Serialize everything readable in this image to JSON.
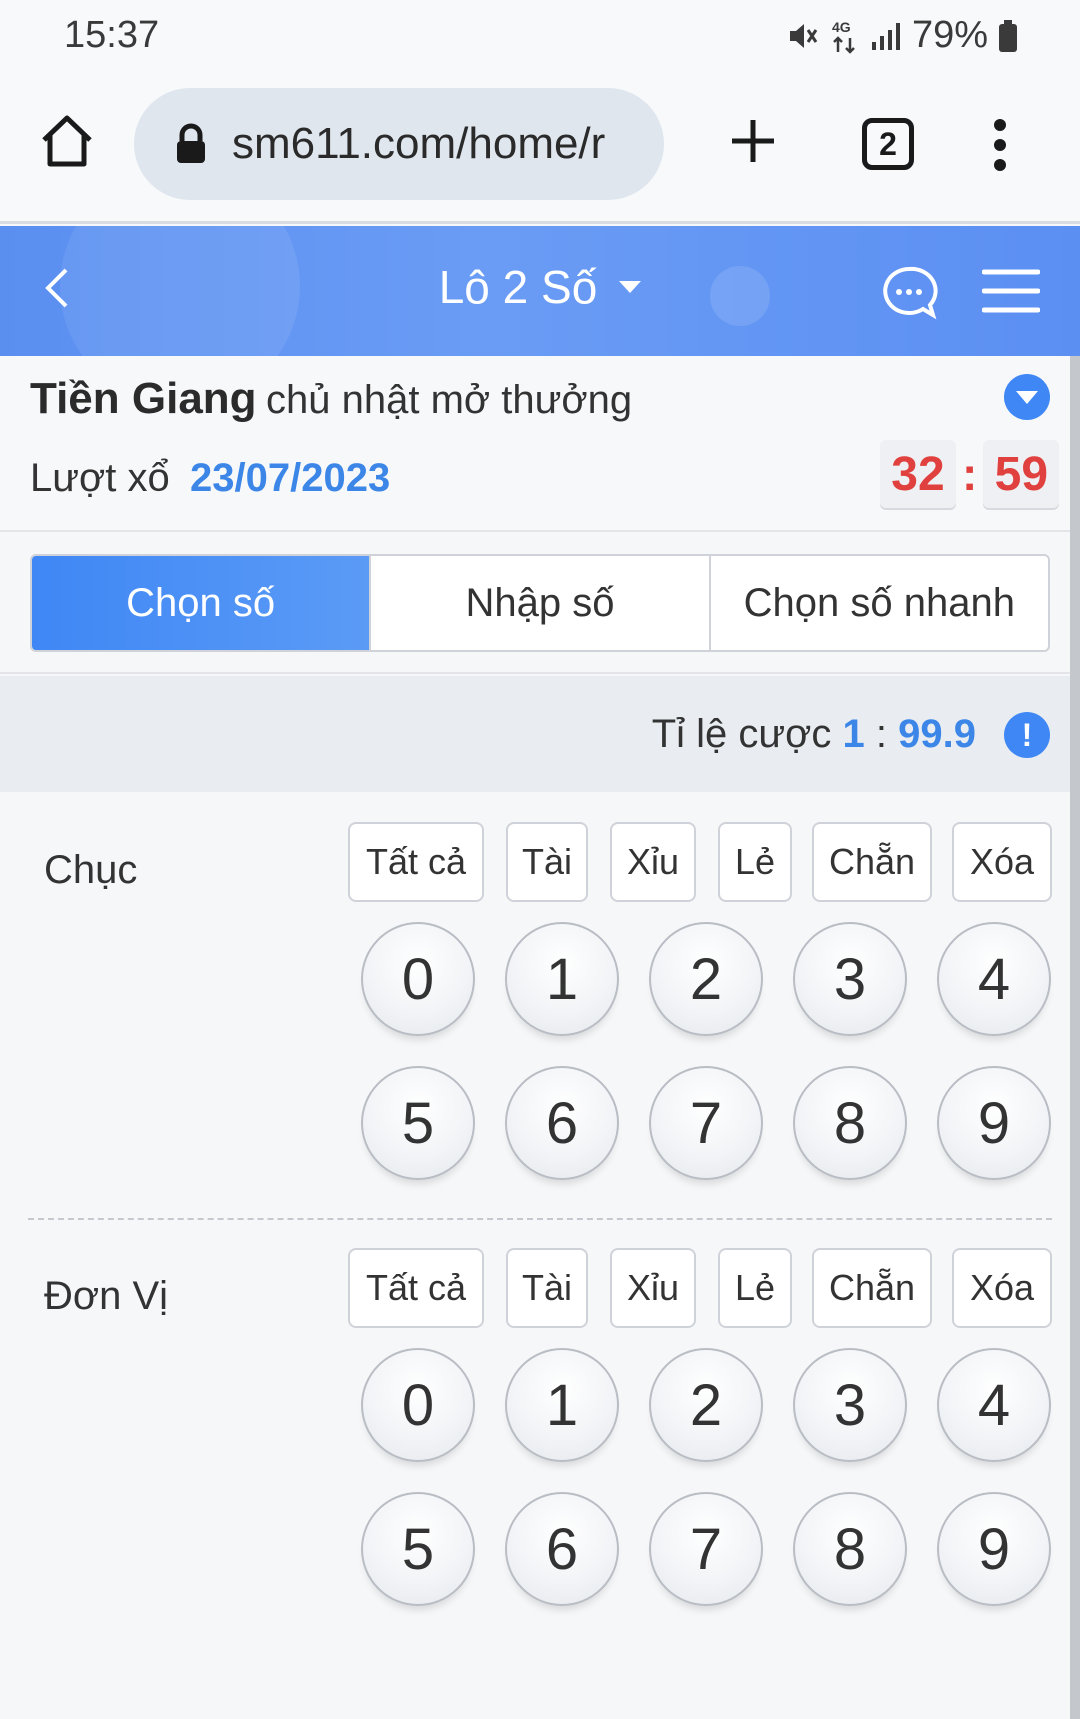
{
  "status_bar": {
    "time": "15:37",
    "network": "4G",
    "battery": "79%",
    "icons": [
      "mute-icon",
      "network-4g-icon",
      "signal-icon",
      "battery-icon"
    ]
  },
  "browser": {
    "url": "sm611.com/home/r",
    "tab_count": "2"
  },
  "header": {
    "title": "Lô 2 Số"
  },
  "lottery": {
    "name": "Tiền Giang",
    "schedule": "chủ nhật mở thưởng",
    "draw_label": "Lượt xổ",
    "draw_date": "23/07/2023",
    "countdown_min": "32",
    "countdown_sec": "59"
  },
  "tabs": [
    {
      "label": "Chọn số",
      "active": true
    },
    {
      "label": "Nhập số",
      "active": false
    },
    {
      "label": "Chọn số nhanh",
      "active": false
    }
  ],
  "odds": {
    "label": "Tỉ lệ cược",
    "left": "1",
    "sep": ":",
    "right": "99.9",
    "info_glyph": "!"
  },
  "quick_options": [
    "Tất cả",
    "Tài",
    "Xỉu",
    "Lẻ",
    "Chẵn",
    "Xóa"
  ],
  "sections": [
    {
      "label": "Chục",
      "digits": [
        "0",
        "1",
        "2",
        "3",
        "4",
        "5",
        "6",
        "7",
        "8",
        "9"
      ]
    },
    {
      "label": "Đơn Vị",
      "digits": [
        "0",
        "1",
        "2",
        "3",
        "4",
        "5",
        "6",
        "7",
        "8",
        "9"
      ]
    }
  ]
}
